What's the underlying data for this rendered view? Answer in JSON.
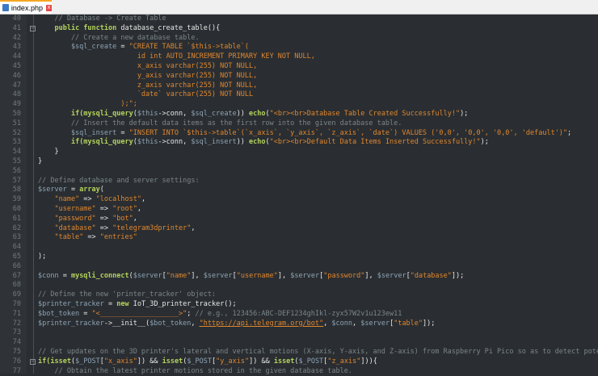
{
  "tab": {
    "label": "index.php",
    "close": "x"
  },
  "colors": {
    "background": "#2a2e32",
    "comment": "#7b8589",
    "keyword": "#b5d35c",
    "string": "#e0862d",
    "variable": "#8ea3b5"
  },
  "lines": [
    {
      "n": "40",
      "t": [
        [
          "c",
          "    // Database -> Create Table"
        ]
      ]
    },
    {
      "n": "41",
      "fold": true,
      "t": [
        [
          "p",
          "    "
        ],
        [
          "k",
          "public function"
        ],
        [
          "p",
          " database_create_table(){"
        ]
      ]
    },
    {
      "n": "42",
      "t": [
        [
          "c",
          "        // Create a new database table."
        ]
      ]
    },
    {
      "n": "43",
      "t": [
        [
          "v",
          "        $sql_create"
        ],
        [
          "p",
          " = "
        ],
        [
          "s",
          "\"CREATE TABLE `$this->table`("
        ]
      ]
    },
    {
      "n": "44",
      "t": [
        [
          "s",
          "                        id int AUTO_INCREMENT PRIMARY KEY NOT NULL,"
        ]
      ]
    },
    {
      "n": "45",
      "t": [
        [
          "s",
          "                        x_axis varchar(255) NOT NULL,"
        ]
      ]
    },
    {
      "n": "46",
      "t": [
        [
          "s",
          "                        y_axis varchar(255) NOT NULL,"
        ]
      ]
    },
    {
      "n": "47",
      "t": [
        [
          "s",
          "                        z_axis varchar(255) NOT NULL,"
        ]
      ]
    },
    {
      "n": "48",
      "t": [
        [
          "s",
          "                        `date` varchar(255) NOT NULL"
        ]
      ]
    },
    {
      "n": "49",
      "t": [
        [
          "s",
          "                    );\";"
        ]
      ]
    },
    {
      "n": "50",
      "t": [
        [
          "p",
          "        "
        ],
        [
          "k",
          "if(mysqli_query"
        ],
        [
          "p",
          "("
        ],
        [
          "v",
          "$this"
        ],
        [
          "p",
          "->conn, "
        ],
        [
          "v",
          "$sql_create"
        ],
        [
          "p",
          ")) "
        ],
        [
          "k",
          "echo"
        ],
        [
          "p",
          "("
        ],
        [
          "s",
          "\"<br><br>Database Table Created Successfully!\""
        ],
        [
          "p",
          ");"
        ]
      ]
    },
    {
      "n": "51",
      "t": [
        [
          "c",
          "        // Insert the default data items as the first row into the given database table."
        ]
      ]
    },
    {
      "n": "52",
      "t": [
        [
          "v",
          "        $sql_insert"
        ],
        [
          "p",
          " = "
        ],
        [
          "s",
          "\"INSERT INTO `$this->table`(`x_axis`, `y_axis`, `z_axis`, `date`) VALUES ('0,0', '0,0', '0,0', 'default')\""
        ],
        [
          "p",
          ";"
        ]
      ]
    },
    {
      "n": "53",
      "t": [
        [
          "p",
          "        "
        ],
        [
          "k",
          "if(mysqli_query"
        ],
        [
          "p",
          "("
        ],
        [
          "v",
          "$this"
        ],
        [
          "p",
          "->conn, "
        ],
        [
          "v",
          "$sql_insert"
        ],
        [
          "p",
          ")) "
        ],
        [
          "k",
          "echo"
        ],
        [
          "p",
          "("
        ],
        [
          "s",
          "\"<br><br>Default Data Items Inserted Successfully!\""
        ],
        [
          "p",
          ");"
        ]
      ]
    },
    {
      "n": "54",
      "t": [
        [
          "p",
          "    }"
        ]
      ]
    },
    {
      "n": "55",
      "t": [
        [
          "p",
          "}"
        ]
      ]
    },
    {
      "n": "56",
      "t": []
    },
    {
      "n": "57",
      "t": [
        [
          "c",
          "// Define database and server settings:"
        ]
      ]
    },
    {
      "n": "58",
      "t": [
        [
          "v",
          "$server"
        ],
        [
          "p",
          " = "
        ],
        [
          "k",
          "array"
        ],
        [
          "p",
          "("
        ]
      ]
    },
    {
      "n": "59",
      "t": [
        [
          "s",
          "    \"name\""
        ],
        [
          "p",
          " => "
        ],
        [
          "s",
          "\"localhost\""
        ],
        [
          "p",
          ","
        ]
      ]
    },
    {
      "n": "60",
      "t": [
        [
          "s",
          "    \"username\""
        ],
        [
          "p",
          " => "
        ],
        [
          "s",
          "\"root\""
        ],
        [
          "p",
          ","
        ]
      ]
    },
    {
      "n": "61",
      "t": [
        [
          "s",
          "    \"password\""
        ],
        [
          "p",
          " => "
        ],
        [
          "s",
          "\"bot\""
        ],
        [
          "p",
          ","
        ]
      ]
    },
    {
      "n": "62",
      "t": [
        [
          "s",
          "    \"database\""
        ],
        [
          "p",
          " => "
        ],
        [
          "s",
          "\"telegram3dprinter\""
        ],
        [
          "p",
          ","
        ]
      ]
    },
    {
      "n": "63",
      "t": [
        [
          "s",
          "    \"table\""
        ],
        [
          "p",
          " => "
        ],
        [
          "s",
          "\"entries\""
        ]
      ]
    },
    {
      "n": "64",
      "t": []
    },
    {
      "n": "65",
      "t": [
        [
          "p",
          ");"
        ]
      ]
    },
    {
      "n": "66",
      "t": []
    },
    {
      "n": "67",
      "t": [
        [
          "v",
          "$conn"
        ],
        [
          "p",
          " = "
        ],
        [
          "k",
          "mysqli_connect"
        ],
        [
          "p",
          "("
        ],
        [
          "v",
          "$server"
        ],
        [
          "p",
          "["
        ],
        [
          "s",
          "\"name\""
        ],
        [
          "p",
          "], "
        ],
        [
          "v",
          "$server"
        ],
        [
          "p",
          "["
        ],
        [
          "s",
          "\"username\""
        ],
        [
          "p",
          "], "
        ],
        [
          "v",
          "$server"
        ],
        [
          "p",
          "["
        ],
        [
          "s",
          "\"password\""
        ],
        [
          "p",
          "], "
        ],
        [
          "v",
          "$server"
        ],
        [
          "p",
          "["
        ],
        [
          "s",
          "\"database\""
        ],
        [
          "p",
          "]);"
        ]
      ]
    },
    {
      "n": "68",
      "t": []
    },
    {
      "n": "69",
      "t": [
        [
          "c",
          "// Define the new 'printer_tracker' object:"
        ]
      ]
    },
    {
      "n": "70",
      "t": [
        [
          "v",
          "$printer_tracker"
        ],
        [
          "p",
          " = "
        ],
        [
          "k",
          "new"
        ],
        [
          "p",
          " IoT_3D_printer_tracker();"
        ]
      ]
    },
    {
      "n": "71",
      "t": [
        [
          "v",
          "$bot_token"
        ],
        [
          "p",
          " = "
        ],
        [
          "s",
          "\"<___________________>\""
        ],
        [
          "p",
          "; "
        ],
        [
          "c",
          "// e.g., 123456:ABC-DEF1234ghIkl-zyx57W2v1u123ew11"
        ]
      ]
    },
    {
      "n": "72",
      "t": [
        [
          "v",
          "$printer_tracker"
        ],
        [
          "p",
          "->__init__("
        ],
        [
          "v",
          "$bot_token"
        ],
        [
          "p",
          ", "
        ],
        [
          "u",
          "\"https://api.telegram.org/bot\""
        ],
        [
          "p",
          ", "
        ],
        [
          "v",
          "$conn"
        ],
        [
          "p",
          ", "
        ],
        [
          "v",
          "$server"
        ],
        [
          "p",
          "["
        ],
        [
          "s",
          "\"table\""
        ],
        [
          "p",
          "]);"
        ]
      ]
    },
    {
      "n": "73",
      "t": []
    },
    {
      "n": "74",
      "t": []
    },
    {
      "n": "75",
      "t": [
        [
          "c",
          "// Get updates on the 3D printer's lateral and vertical motions (X-axis, Y-axis, and Z-axis) from Raspberry Pi Pico so as to detect pote"
        ]
      ]
    },
    {
      "n": "76",
      "fold": true,
      "t": [
        [
          "k",
          "if(isset"
        ],
        [
          "p",
          "("
        ],
        [
          "v",
          "$_POST"
        ],
        [
          "p",
          "["
        ],
        [
          "s",
          "\"x_axis\""
        ],
        [
          "p",
          "]) && "
        ],
        [
          "k",
          "isset"
        ],
        [
          "p",
          "("
        ],
        [
          "v",
          "$_POST"
        ],
        [
          "p",
          "["
        ],
        [
          "s",
          "\"y_axis\""
        ],
        [
          "p",
          "]) && "
        ],
        [
          "k",
          "isset"
        ],
        [
          "p",
          "("
        ],
        [
          "v",
          "$_POST"
        ],
        [
          "p",
          "["
        ],
        [
          "s",
          "\"z_axis\""
        ],
        [
          "p",
          "])){"
        ]
      ]
    },
    {
      "n": "77",
      "t": [
        [
          "c",
          "    // Obtain the latest printer motions stored in the given database table."
        ]
      ]
    }
  ]
}
